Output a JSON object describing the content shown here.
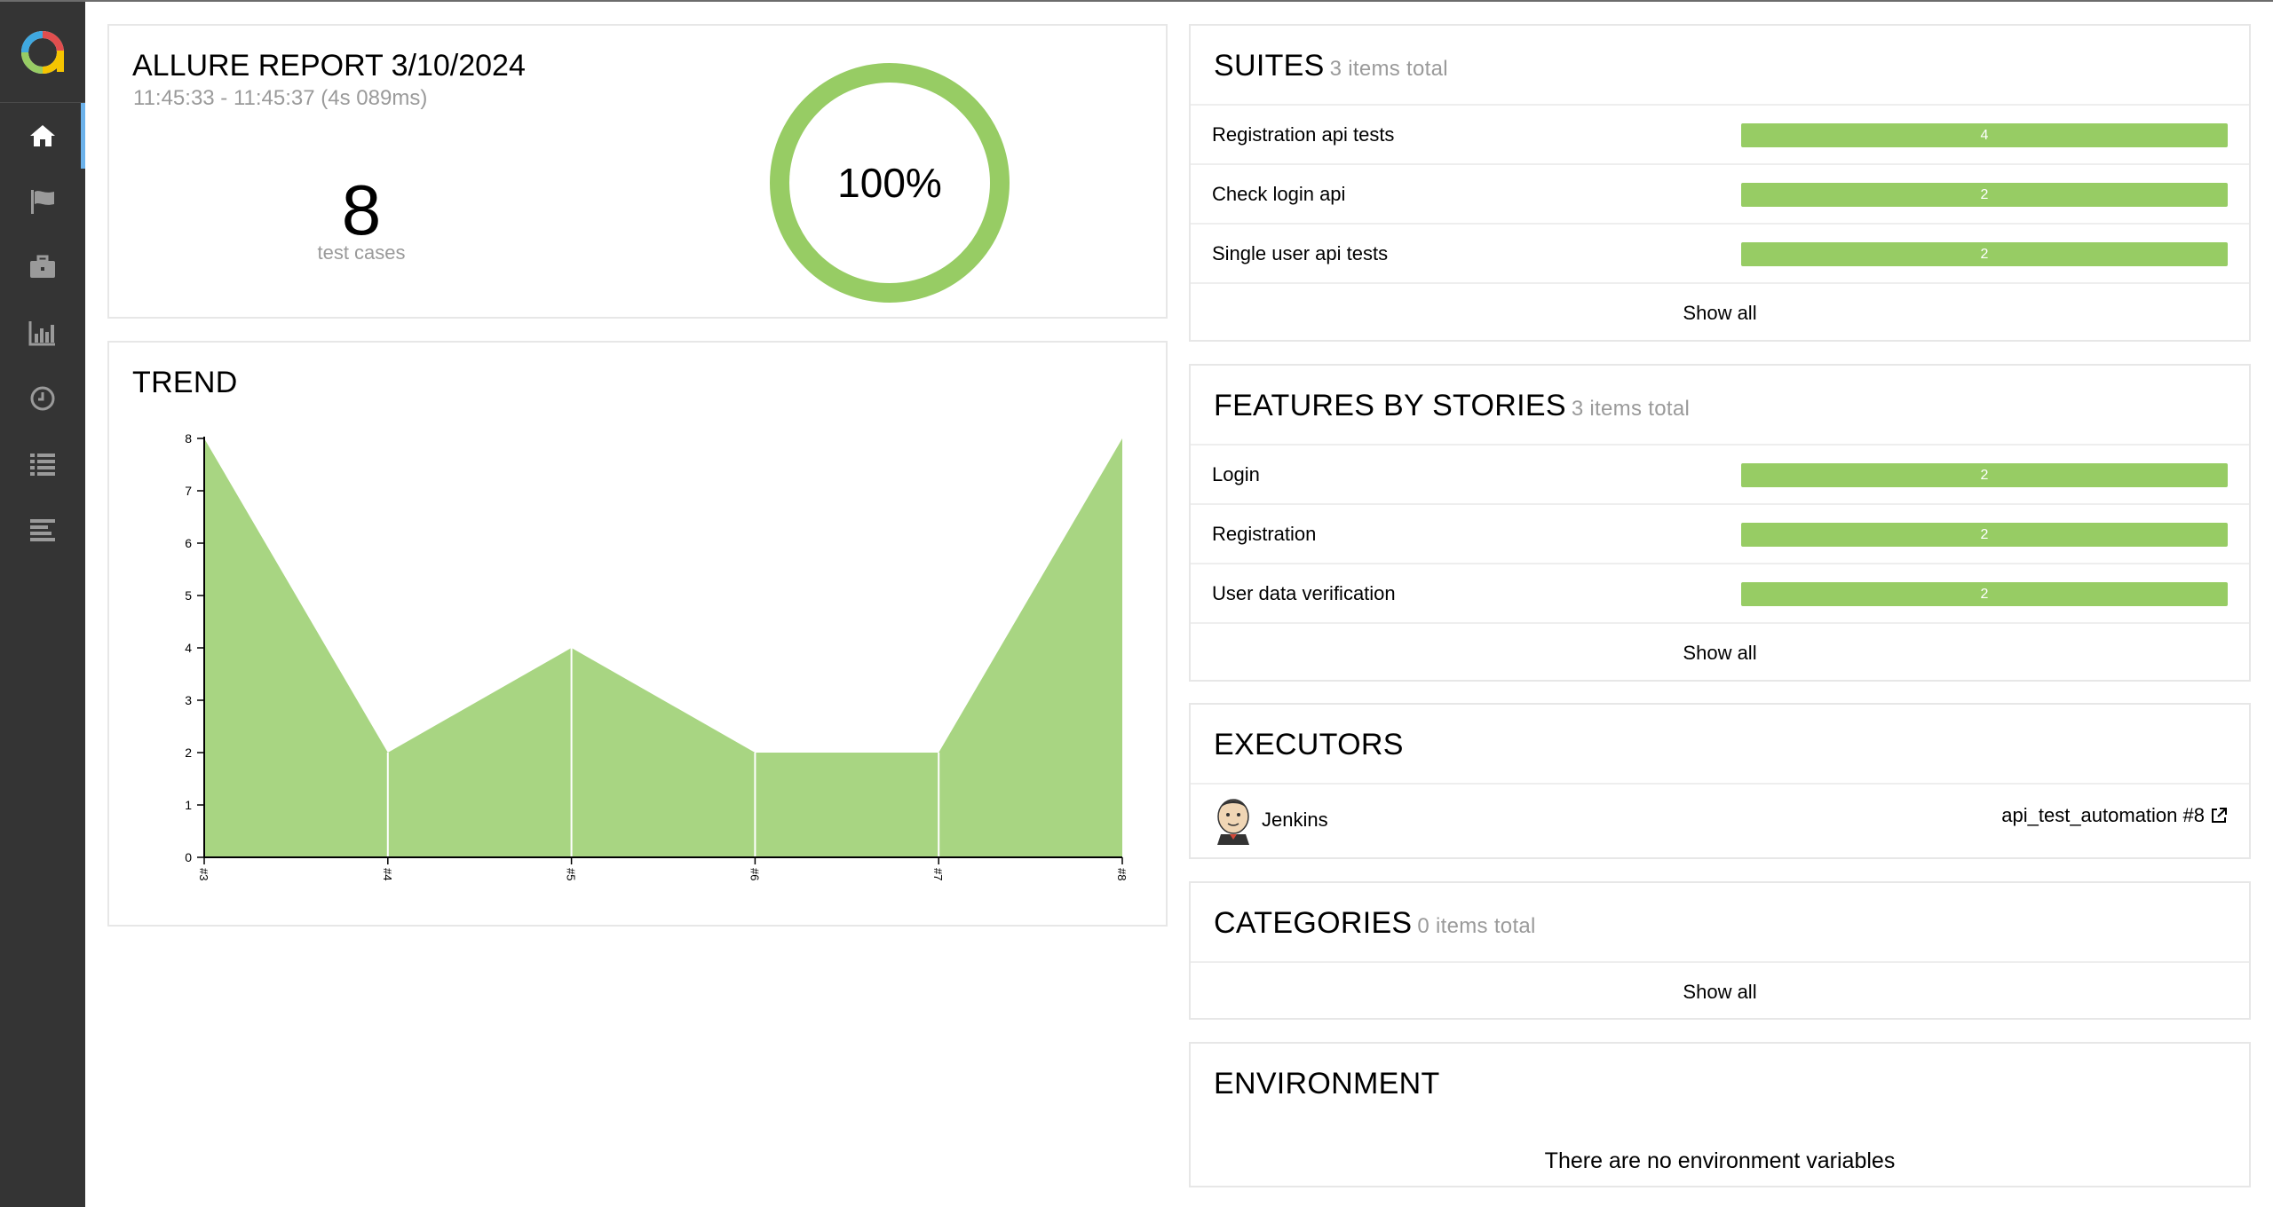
{
  "sidebar": {
    "items": [
      {
        "name": "overview",
        "icon": "home-icon",
        "active": true
      },
      {
        "name": "categories",
        "icon": "flag-icon"
      },
      {
        "name": "suites",
        "icon": "briefcase-icon"
      },
      {
        "name": "graphs",
        "icon": "bar-chart-icon"
      },
      {
        "name": "timeline",
        "icon": "clock-icon"
      },
      {
        "name": "behaviors",
        "icon": "list-icon"
      },
      {
        "name": "packages",
        "icon": "align-left-icon"
      }
    ],
    "accent": "#6cb2eb"
  },
  "summary": {
    "title": "ALLURE REPORT 3/10/2024",
    "time": "11:45:33 - 11:45:37 (4s 089ms)",
    "count": "8",
    "count_label": "test cases",
    "percent": "100%",
    "passed_color": "#97cc64"
  },
  "trend": {
    "title": "TREND"
  },
  "chart_data": {
    "type": "area",
    "title": "TREND",
    "x": [
      "#3",
      "#4",
      "#5",
      "#6",
      "#7",
      "#8"
    ],
    "values": [
      8,
      2,
      4,
      2,
      2,
      8
    ],
    "ylim": [
      0,
      8
    ],
    "yticks": [
      "0",
      "1",
      "2",
      "3",
      "4",
      "5",
      "6",
      "7",
      "8"
    ],
    "color": "#97cc64",
    "grid": false
  },
  "suites": {
    "title": "SUITES",
    "subtitle": "3 items total",
    "items": [
      {
        "name": "Registration api tests",
        "count": "4"
      },
      {
        "name": "Check login api",
        "count": "2"
      },
      {
        "name": "Single user api tests",
        "count": "2"
      }
    ],
    "show_all": "Show all"
  },
  "features": {
    "title": "FEATURES BY STORIES",
    "subtitle": "3 items total",
    "items": [
      {
        "name": "Login",
        "count": "2"
      },
      {
        "name": "Registration",
        "count": "2"
      },
      {
        "name": "User data verification",
        "count": "2"
      }
    ],
    "show_all": "Show all"
  },
  "executors": {
    "title": "EXECUTORS",
    "name": "Jenkins",
    "build": "api_test_automation #8"
  },
  "categories": {
    "title": "CATEGORIES",
    "subtitle": "0 items total",
    "show_all": "Show all"
  },
  "environment": {
    "title": "ENVIRONMENT",
    "empty": "There are no environment variables"
  }
}
